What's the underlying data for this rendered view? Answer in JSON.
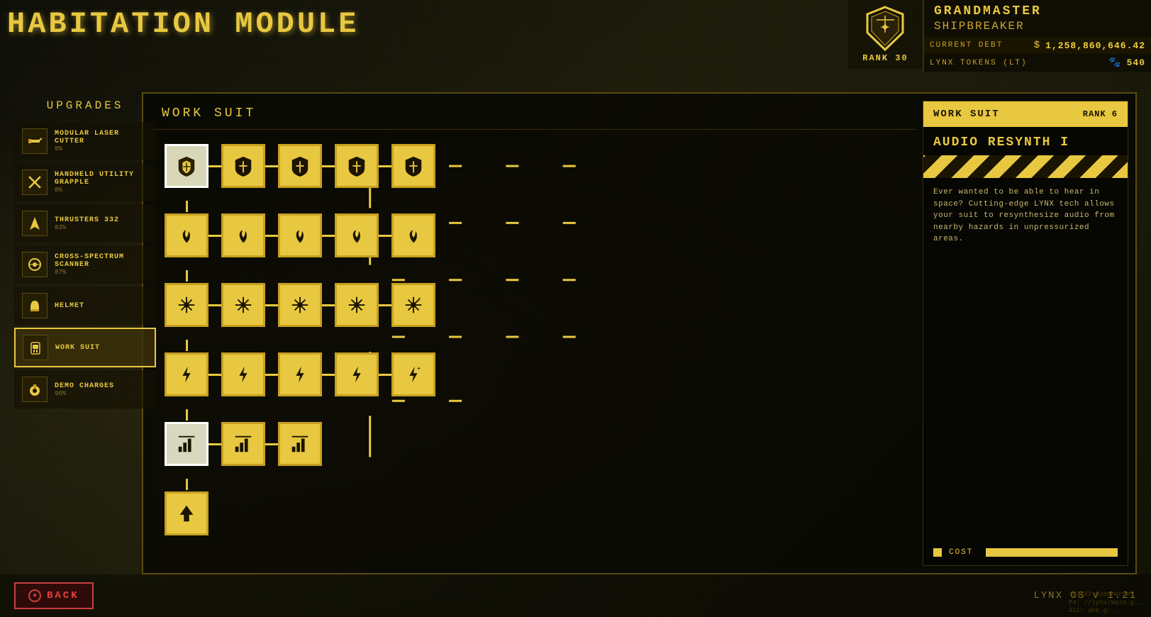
{
  "title": "HABITATION MODULE",
  "header": {
    "rank_label": "RANK 30",
    "player_title": "GRANDMASTER",
    "player_subtitle": "SHIPBREAKER",
    "debt_label": "CURRENT DEBT",
    "debt_currency": "$",
    "debt_value": "1,258,860,646.42",
    "tokens_label": "LYNX TOKENS (LT)",
    "tokens_value": "540"
  },
  "sidebar": {
    "title": "UPGRADES",
    "items": [
      {
        "id": "modular-laser-cutter",
        "name": "MODULAR LASER CUTTER",
        "pct": "8%",
        "icon": "✂"
      },
      {
        "id": "handheld-utility-grapple",
        "name": "HANDHELD UTILITY GRAPPLE",
        "pct": "8%",
        "icon": "🔱"
      },
      {
        "id": "thrusters",
        "name": "THRUSTERS 332",
        "pct": "83%",
        "icon": "⬆"
      },
      {
        "id": "cross-spectrum-scanner",
        "name": "CROSS-SPECTRUM SCANNER",
        "pct": "87%",
        "icon": "◎"
      },
      {
        "id": "helmet",
        "name": "HELMET",
        "pct": "",
        "icon": "⛑"
      },
      {
        "id": "work-suit",
        "name": "WORK SUIT",
        "pct": "",
        "icon": "🧑",
        "active": true
      },
      {
        "id": "demo-charges",
        "name": "DEMO CHARGES",
        "pct": "90%",
        "icon": "💥"
      }
    ]
  },
  "upgrade_tree": {
    "section_title": "WORK SUIT",
    "rows": [
      [
        "shield+",
        "shield",
        "shield",
        "shield",
        "shield"
      ],
      [
        "flame",
        "flame",
        "flame",
        "flame",
        "flame+"
      ],
      [
        "snowflake",
        "snowflake",
        "snowflake",
        "snowflake",
        "snowflake+"
      ],
      [
        "bolt",
        "bolt",
        "bolt",
        "bolt",
        "bolt+"
      ],
      [
        "bar",
        "bar",
        "bar"
      ],
      [
        "arrow"
      ]
    ]
  },
  "info_panel": {
    "title": "WORK SUIT",
    "rank": "RANK 6",
    "upgrade_name": "AUDIO RESYNTH I",
    "description": "Ever wanted to be able to hear in space? Cutting-edge LYNX tech allows your suit to resynthesize audio from nearby hazards in unpressurized areas.",
    "cost_label": "COST"
  },
  "footer": {
    "back_label": "BACK",
    "os_version": "LYNX OS v 1.21",
    "git_info": "182502-CyanMarge\nP4: //lynx/main.g...\nGit: unk.g..."
  }
}
